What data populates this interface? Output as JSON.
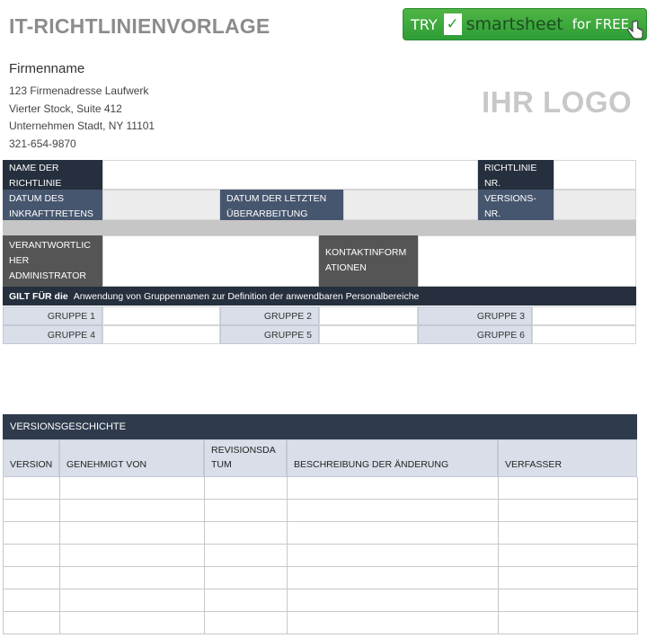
{
  "title": "IT-RICHTLINIENVORLAGE",
  "banner": {
    "try": "TRY",
    "check": "✓",
    "brand": "smartsheet",
    "free": "for FREE"
  },
  "company": {
    "name": "Firmenname",
    "address_lines": [
      "123 Firmenadresse Laufwerk",
      "Vierter Stock, Suite 412",
      "Unternehmen Stadt, NY 11101",
      "321-654-9870"
    ]
  },
  "logo": "IHR LOGO",
  "policy": {
    "name_label_1": "NAME DER",
    "name_label_2": "RICHTLINIE",
    "number_label_1": "RICHTLINIE",
    "number_label_2": "NR.",
    "effective_label_1": "DATUM DES",
    "effective_label_2": "INKRAFTTRETENS",
    "revision_label_1": "DATUM DER LETZTEN",
    "revision_label_2": "ÜBERARBEITUNG",
    "version_label_1": "VERSIONS-",
    "version_label_2": "NR.",
    "admin_label_1": "VERANTWORTLIC",
    "admin_label_2": "HER",
    "admin_label_3": "ADMINISTRATOR",
    "contact_label_1": "KONTAKTINFORM",
    "contact_label_2": "ATIONEN"
  },
  "applies": {
    "label": "GILT FÜR die",
    "text": "Anwendung von Gruppennamen zur Definition der anwendbaren Personalbereiche"
  },
  "groups": [
    "GRUPPE 1",
    "GRUPPE 2",
    "GRUPPE 3",
    "GRUPPE 4",
    "GRUPPE 5",
    "GRUPPE 6"
  ],
  "version_history": {
    "title": "VERSIONSGESCHICHTE",
    "columns": [
      "VERSION",
      "GENEHMIGT VON",
      "REVISIONSDA",
      "TUM",
      "BESCHREIBUNG DER ÄNDERUNG",
      "VERFASSER"
    ]
  }
}
